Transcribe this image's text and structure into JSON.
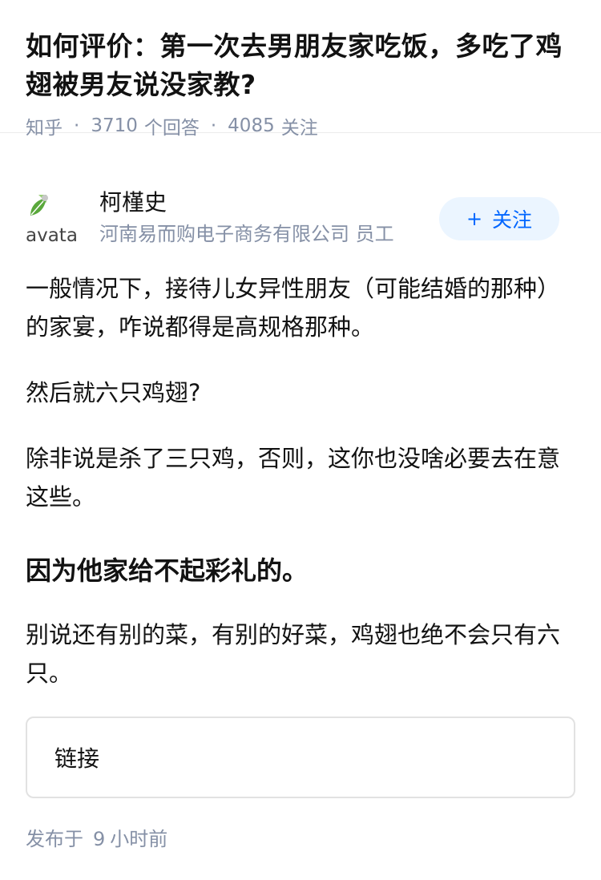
{
  "question": {
    "title": "如何评价：第一次去男朋友家吃饭，多吃了鸡翅被男友说没家教?",
    "source": "知乎",
    "separator": "·",
    "answers_count": "3710",
    "answers_label": "个回答",
    "follow_count": "4085",
    "follow_label": "关注"
  },
  "author": {
    "avatar_alt": "avatar",
    "name": "柯槿史",
    "org": "河南易而购电子商务有限公司 员工",
    "follow_button": {
      "plus": "+",
      "label": "关注",
      "color": "#0066ff",
      "background": "#ebf5ff"
    }
  },
  "answer": {
    "paragraph_1": "一般情况下，接待儿女异性朋友（可能结婚的那种）的家宴，咋说都得是高规格那种。",
    "paragraph_2": "然后就六只鸡翅?",
    "paragraph_3": "除非说是杀了三只鸡，否则，这你也没啥必要去在意这些。",
    "heading": "因为他家给不起彩礼的。",
    "paragraph_4": "别说还有别的菜，有别的好菜，鸡翅也绝不会只有六只。"
  },
  "link_card": {
    "label": "链接"
  },
  "publish": {
    "prefix": "发布于",
    "number": "9",
    "unit": "小时前"
  }
}
